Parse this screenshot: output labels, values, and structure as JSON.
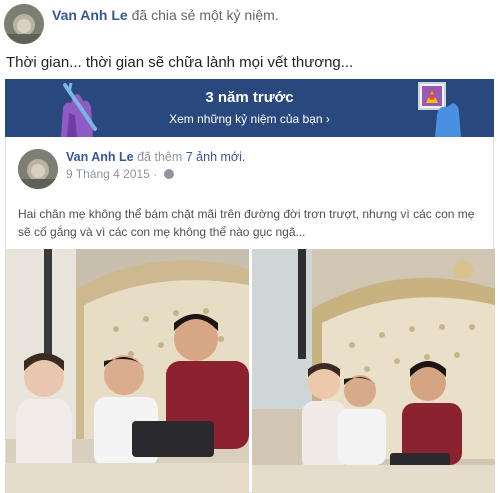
{
  "header": {
    "author": "Van Anh Le",
    "action": "đã chia sẻ một kỷ niệm."
  },
  "status_text": "Thời gian... thời gian sẽ chữa lành mọi vết thương...",
  "memory_banner": {
    "title": "3 năm trước",
    "link": "Xem những kỷ niệm của bạn ›",
    "colors": {
      "background": "#29487d"
    }
  },
  "original_post": {
    "author": "Van Anh Le",
    "action_prefix": "đã thêm",
    "photo_count": "7 ảnh mới.",
    "date": "9 Tháng 4 2015 ·",
    "caption": "Hai chân mẹ không thể bám chặt mãi trên đường đời trơn trượt, nhưng vì các con mẹ sẽ cố gắng và vì các con mẹ không thể nào gục ngã..."
  },
  "icons": [
    "avatar",
    "hand-sticker-icon",
    "photo-sticker-icon",
    "globe-icon"
  ],
  "colors": {
    "link": "#365899",
    "meta": "#90949c"
  }
}
